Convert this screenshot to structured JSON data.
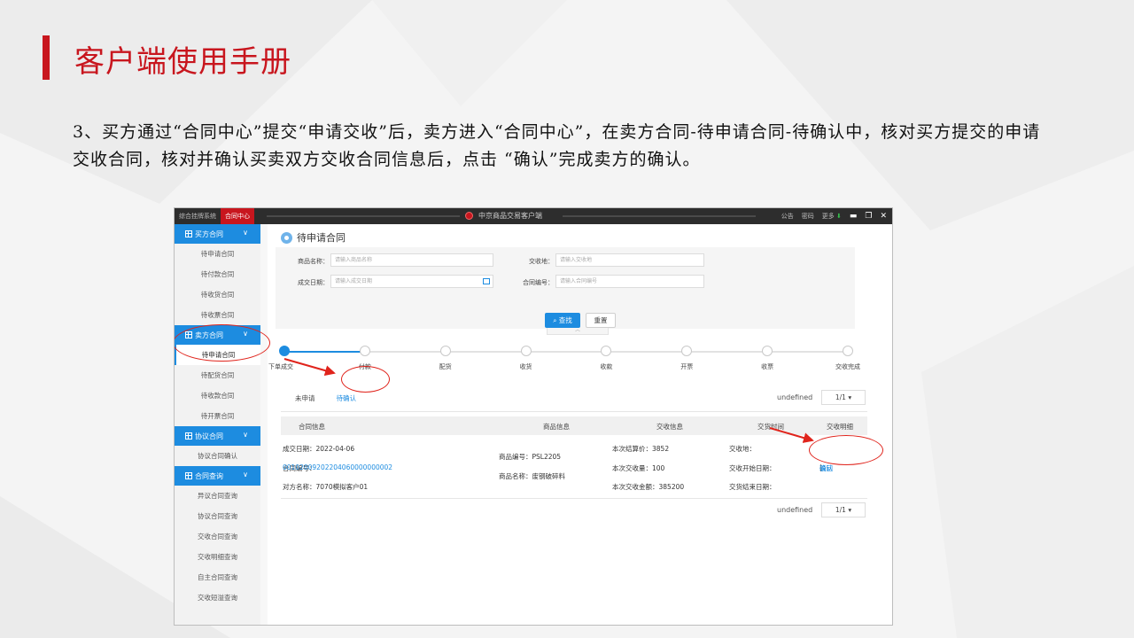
{
  "slide": {
    "title": "客户端使用手册",
    "body": "3、买方通过“合同中心”提交“申请交收”后，卖方进入“合同中心”，在卖方合同-待申请合同-待确认中，核对买方提交的申请交收合同，核对并确认买卖双方交收合同信息后，点击 “确认”完成卖方的确认。"
  },
  "colors": {
    "accent": "#c8161e",
    "primary": "#1d8ce0",
    "annotation": "#e0241c"
  },
  "titlebar": {
    "tabs": [
      "综合挂牌系统",
      "合同中心"
    ],
    "app_title": "中京商品交易客户端",
    "right_items": [
      "公告",
      "密码",
      "更多"
    ],
    "controls": [
      "minimize-icon",
      "restore-icon",
      "close-icon"
    ],
    "min_glyph": "▬",
    "restore_glyph": "❐",
    "close_glyph": "✕",
    "more_arrow": "⬇"
  },
  "sidebar": {
    "groups": [
      {
        "label": "买方合同",
        "items": [
          "待申请合同",
          "待付款合同",
          "待收货合同",
          "待收票合同"
        ]
      },
      {
        "label": "卖方合同",
        "items": [
          "待申请合同",
          "待配货合同",
          "待收款合同",
          "待开票合同"
        ]
      },
      {
        "label": "协议合同",
        "items": [
          "协议合同确认"
        ]
      },
      {
        "label": "合同查询",
        "items": [
          "异议合同查询",
          "协议合同查询",
          "交收合同查询",
          "交收明细查询",
          "自主合同查询",
          "交收短溢查询"
        ]
      }
    ]
  },
  "page": {
    "title": "待申请合同",
    "filters": {
      "product_label": "商品名称：",
      "product_placeholder": "请输入商品名称",
      "place_label": "交收地：",
      "place_placeholder": "请输入交收地",
      "date_label": "成交日期：",
      "date_placeholder": "请输入成交日期",
      "contract_label": "合同编号：",
      "contract_placeholder": "请输入合同编号"
    },
    "search_label": "查找",
    "reset_label": "重置",
    "collapse_glyph": "︿"
  },
  "steps": [
    "下单成交",
    "付款",
    "配货",
    "收货",
    "收款",
    "开票",
    "收票",
    "交收完成"
  ],
  "steps_completed": 1,
  "tabs": [
    "未申请",
    "待确认"
  ],
  "pager": {
    "prefix": "undefined",
    "value": "1/1 ▾"
  },
  "table": {
    "headers": [
      "合同信息",
      "商品信息",
      "交收信息",
      "交货时间",
      "交收明细"
    ],
    "row": {
      "deal_date": "成交日期：2022-04-06",
      "contract_label": "合同编号：",
      "contract_no": "00102009202204060000000002",
      "counterparty": "对方名称：7070模拟客户01",
      "product_no": "商品编号：PSL2205",
      "product_name": "商品名称：废钢破碎料",
      "settle_price": "本次结算价：3852",
      "settle_qty": "本次交收量：100",
      "settle_amount": "本次交收金额：385200",
      "delivery_place": "交收地：",
      "delivery_start": "交收开始日期：",
      "delivery_end": "交货结束日期：",
      "confirm": "确认",
      "separator": " | ",
      "reject": "驳回"
    }
  }
}
